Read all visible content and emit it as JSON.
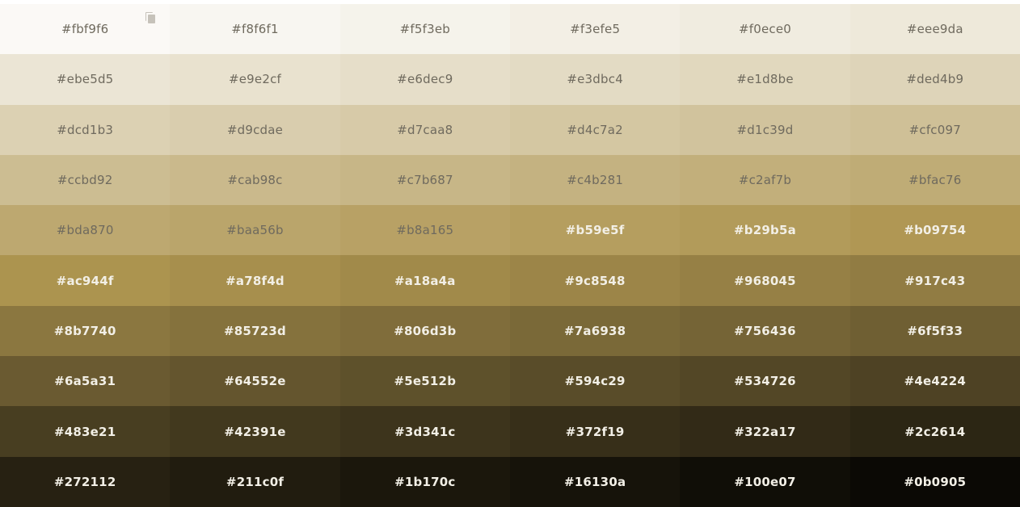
{
  "palette": {
    "copy_icon": "copy-icon",
    "rows": [
      [
        "#fbf9f6",
        "#f8f6f1",
        "#f5f3eb",
        "#f3efe5",
        "#f0ece0",
        "#eee9da"
      ],
      [
        "#ebe5d5",
        "#e9e2cf",
        "#e6dec9",
        "#e3dbc4",
        "#e1d8be",
        "#ded4b9"
      ],
      [
        "#dcd1b3",
        "#d9cdae",
        "#d7caa8",
        "#d4c7a2",
        "#d1c39d",
        "#cfc097"
      ],
      [
        "#ccbd92",
        "#cab98c",
        "#c7b687",
        "#c4b281",
        "#c2af7b",
        "#bfac76"
      ],
      [
        "#bda870",
        "#baa56b",
        "#b8a165",
        "#b59e5f",
        "#b29b5a",
        "#b09754"
      ],
      [
        "#ac944f",
        "#a78f4d",
        "#a18a4a",
        "#9c8548",
        "#968045",
        "#917c43"
      ],
      [
        "#8b7740",
        "#85723d",
        "#806d3b",
        "#7a6938",
        "#756436",
        "#6f5f33"
      ],
      [
        "#6a5a31",
        "#64552e",
        "#5e512b",
        "#594c29",
        "#534726",
        "#4e4224"
      ],
      [
        "#483e21",
        "#42391e",
        "#3d341c",
        "#372f19",
        "#322a17",
        "#2c2614"
      ],
      [
        "#272112",
        "#211c0f",
        "#1b170c",
        "#16130a",
        "#100e07",
        "#0b0905"
      ]
    ],
    "light_text_until": [
      "#b8a165"
    ]
  }
}
